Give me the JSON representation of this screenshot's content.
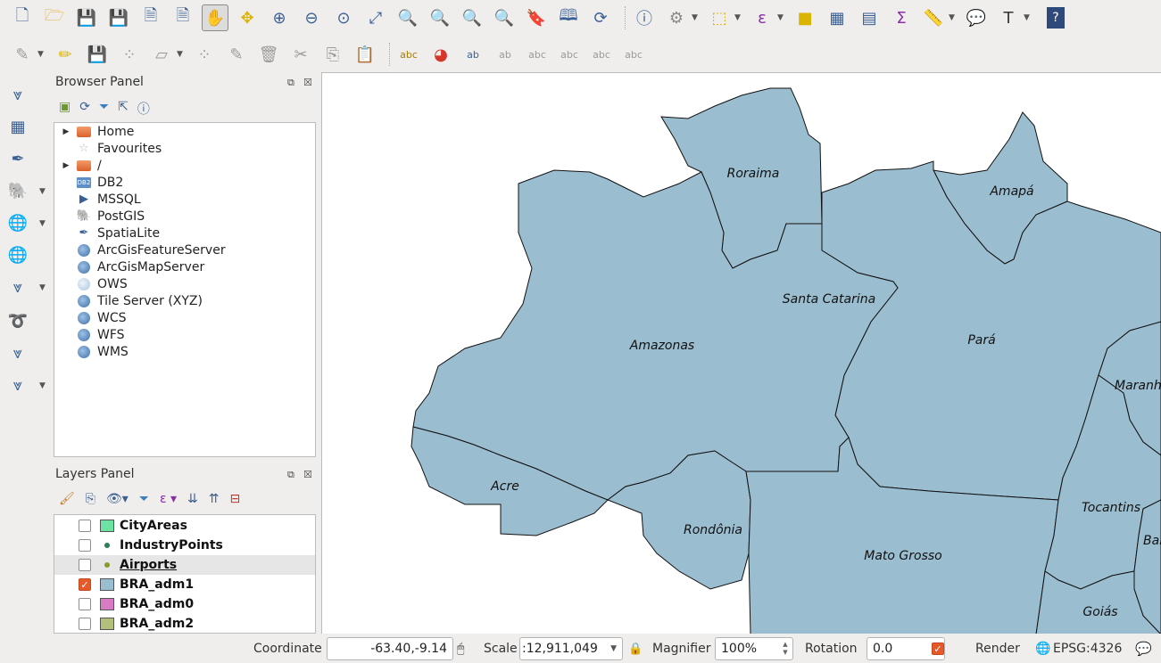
{
  "browser_panel": {
    "title": "Browser Panel",
    "items": [
      {
        "label": "Home",
        "icon": "folder-icon",
        "expandable": true
      },
      {
        "label": "Favourites",
        "icon": "star-icon",
        "expandable": false
      },
      {
        "label": "/",
        "icon": "folder-icon",
        "expandable": true
      },
      {
        "label": "DB2",
        "icon": "db2-icon",
        "expandable": false
      },
      {
        "label": "MSSQL",
        "icon": "mssql-icon",
        "expandable": false
      },
      {
        "label": "PostGIS",
        "icon": "postgis-icon",
        "expandable": false
      },
      {
        "label": "SpatiaLite",
        "icon": "spatialite-icon",
        "expandable": false
      },
      {
        "label": "ArcGisFeatureServer",
        "icon": "arcgis-icon",
        "expandable": false
      },
      {
        "label": "ArcGisMapServer",
        "icon": "arcgis-icon",
        "expandable": false
      },
      {
        "label": "OWS",
        "icon": "globe-icon",
        "expandable": false
      },
      {
        "label": "Tile Server (XYZ)",
        "icon": "globe-icon",
        "expandable": false
      },
      {
        "label": "WCS",
        "icon": "globe-icon",
        "expandable": false
      },
      {
        "label": "WFS",
        "icon": "globe-icon",
        "expandable": false
      },
      {
        "label": "WMS",
        "icon": "globe-icon",
        "expandable": false
      }
    ],
    "db2_text": "DB2"
  },
  "layers_panel": {
    "title": "Layers Panel",
    "layers": [
      {
        "name": "CityAreas",
        "checked": false,
        "symbol": "fill",
        "color": "#6de3a3"
      },
      {
        "name": "IndustryPoints",
        "checked": false,
        "symbol": "point",
        "color": "#2e7d5b"
      },
      {
        "name": "Airports",
        "checked": false,
        "symbol": "point",
        "color": "#8a9a2e"
      },
      {
        "name": "BRA_adm1",
        "checked": true,
        "symbol": "fill",
        "color": "#9bbdd0"
      },
      {
        "name": "BRA_adm0",
        "checked": false,
        "symbol": "fill",
        "color": "#d77bc4"
      },
      {
        "name": "BRA_adm2",
        "checked": false,
        "symbol": "fill",
        "color": "#b2c07c"
      }
    ]
  },
  "map": {
    "fill_color": "#9bbdd0",
    "labels": [
      "Roraima",
      "Amapá",
      "Santa Catarina",
      "Amazonas",
      "Pará",
      "Maranhão",
      "Acre",
      "Rondônia",
      "Mato Grosso",
      "Tocantins",
      "Bahia",
      "Goiás"
    ]
  },
  "status": {
    "coordinate_label": "Coordinate",
    "coordinate_value": "-63.40,-9.14",
    "scale_label": "Scale",
    "scale_value": ":12,911,049",
    "magnifier_label": "Magnifier",
    "magnifier_value": "100%",
    "rotation_label": "Rotation",
    "rotation_value": "0.0",
    "render_label": "Render",
    "crs_label": "EPSG:4326"
  },
  "colors": {
    "accent": "#e5592a",
    "toolbar_icon": "#3a5f94"
  }
}
